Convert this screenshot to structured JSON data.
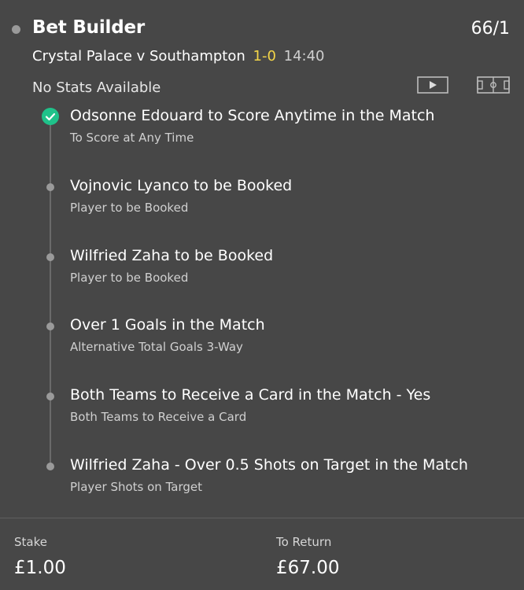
{
  "header": {
    "title": "Bet Builder",
    "odds": "66/1"
  },
  "fixture": {
    "teams": "Crystal Palace v Southampton",
    "score": "1-0",
    "time": "14:40",
    "score_color": "#f3d548"
  },
  "stats": {
    "message": "No Stats Available",
    "video_icon": "video-play-icon",
    "pitch_icon": "pitch-icon"
  },
  "legs": [
    {
      "selection": "Odsonne Edouard to Score Anytime in the Match",
      "market": "To Score at Any Time",
      "status": "won",
      "status_color": "#1fc28a"
    },
    {
      "selection": "Vojnovic Lyanco to be Booked",
      "market": "Player to be Booked",
      "status": "pending"
    },
    {
      "selection": "Wilfried Zaha to be Booked",
      "market": "Player to be Booked",
      "status": "pending"
    },
    {
      "selection": "Over 1 Goals in the Match",
      "market": "Alternative Total Goals 3-Way",
      "status": "pending"
    },
    {
      "selection": "Both Teams to Receive a Card in the Match - Yes",
      "market": "Both Teams to Receive a Card",
      "status": "pending"
    },
    {
      "selection": "Wilfried Zaha - Over 0.5 Shots on Target in the Match",
      "market": "Player Shots on Target",
      "status": "pending"
    }
  ],
  "footer": {
    "stake_label": "Stake",
    "stake_value": "£1.00",
    "return_label": "To Return",
    "return_value": "£67.00"
  }
}
